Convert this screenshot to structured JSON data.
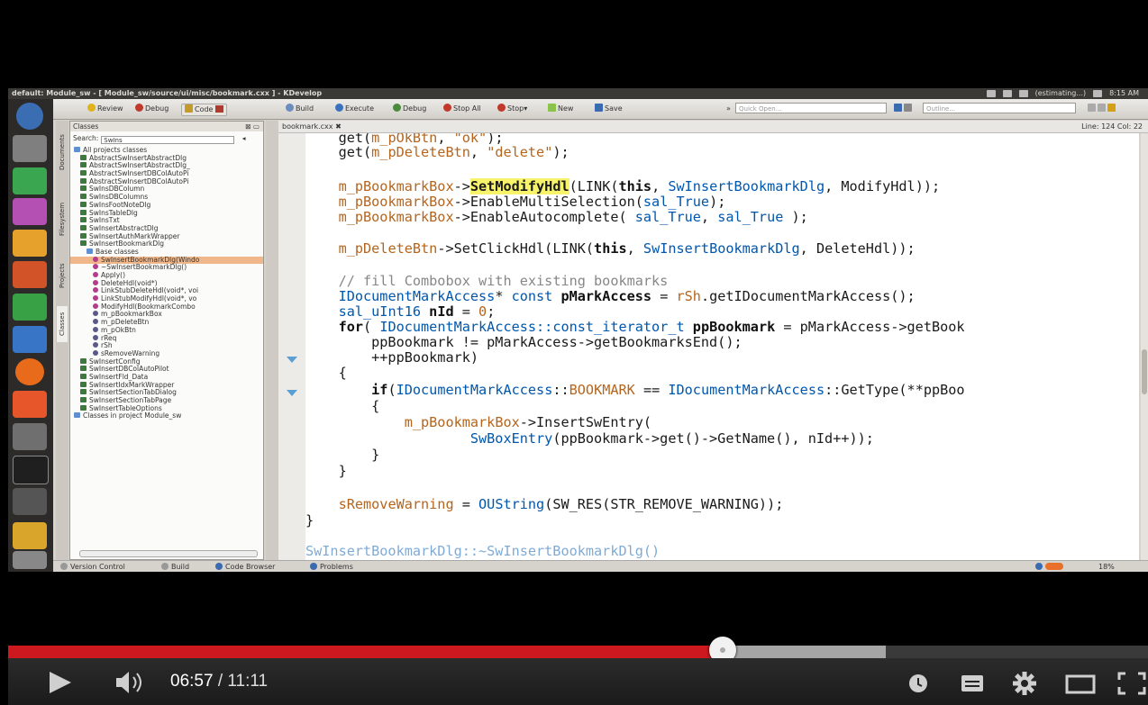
{
  "ide": {
    "window_title": "default: Module_sw - [ Module_sw/source/ui/misc/bookmark.cxx ] - KDevelop",
    "tray_status": "(estimating...)",
    "clock": "8:15 AM",
    "toolbar": {
      "review": "Review",
      "debug_area": "Debug",
      "code_area": "Code",
      "build": "Build",
      "execute": "Execute",
      "debug": "Debug",
      "stop_all": "Stop All",
      "stop": "Stop",
      "new": "New",
      "save": "Save",
      "quick_open_placeholder": "Quick Open...",
      "outline_placeholder": "Outline..."
    },
    "side_tabs": [
      "Documents",
      "Filesystem",
      "Projects",
      "Classes"
    ],
    "classes_panel": {
      "header": "Classes",
      "search_label": "Search:",
      "search_value": "SwIns",
      "tree": [
        {
          "label": "All projects classes",
          "indent": 0,
          "icon": "folder"
        },
        {
          "label": "AbstractSwInsertAbstractDlg",
          "indent": 1,
          "icon": "class"
        },
        {
          "label": "AbstractSwInsertAbstractDlg_",
          "indent": 1,
          "icon": "class"
        },
        {
          "label": "AbstractSwInsertDBColAutoPi",
          "indent": 1,
          "icon": "class"
        },
        {
          "label": "AbstractSwInsertDBColAutoPi",
          "indent": 1,
          "icon": "class"
        },
        {
          "label": "SwInsDBColumn",
          "indent": 1,
          "icon": "class"
        },
        {
          "label": "SwInsDBColumns",
          "indent": 1,
          "icon": "class"
        },
        {
          "label": "SwInsFootNoteDlg",
          "indent": 1,
          "icon": "class"
        },
        {
          "label": "SwInsTableDlg",
          "indent": 1,
          "icon": "class"
        },
        {
          "label": "SwInsTxt",
          "indent": 1,
          "icon": "class"
        },
        {
          "label": "SwInsertAbstractDlg",
          "indent": 1,
          "icon": "class"
        },
        {
          "label": "SwInsertAuthMarkWrapper",
          "indent": 1,
          "icon": "class"
        },
        {
          "label": "SwInsertBookmarkDlg",
          "indent": 1,
          "icon": "class"
        },
        {
          "label": "Base classes",
          "indent": 2,
          "icon": "folder"
        },
        {
          "label": "SwInsertBookmarkDlg(Windo",
          "indent": 3,
          "icon": "method",
          "selected": true
        },
        {
          "label": "~SwInsertBookmarkDlg()",
          "indent": 3,
          "icon": "method"
        },
        {
          "label": "Apply()",
          "indent": 3,
          "icon": "method"
        },
        {
          "label": "DeleteHdl(void*)",
          "indent": 3,
          "icon": "method"
        },
        {
          "label": "LinkStubDeleteHdl(void*, voi",
          "indent": 3,
          "icon": "method"
        },
        {
          "label": "LinkStubModifyHdl(void*, vo",
          "indent": 3,
          "icon": "method"
        },
        {
          "label": "ModifyHdl(BookmarkCombo",
          "indent": 3,
          "icon": "method"
        },
        {
          "label": "m_pBookmarkBox",
          "indent": 3,
          "icon": "member"
        },
        {
          "label": "m_pDeleteBtn",
          "indent": 3,
          "icon": "member"
        },
        {
          "label": "m_pOkBtn",
          "indent": 3,
          "icon": "member"
        },
        {
          "label": "rReq",
          "indent": 3,
          "icon": "member"
        },
        {
          "label": "rSh",
          "indent": 3,
          "icon": "member"
        },
        {
          "label": "sRemoveWarning",
          "indent": 3,
          "icon": "member"
        },
        {
          "label": "SwInsertConfig",
          "indent": 1,
          "icon": "class"
        },
        {
          "label": "SwInsertDBColAutoPilot",
          "indent": 1,
          "icon": "class"
        },
        {
          "label": "SwInsertFld_Data",
          "indent": 1,
          "icon": "class"
        },
        {
          "label": "SwInsertIdxMarkWrapper",
          "indent": 1,
          "icon": "class"
        },
        {
          "label": "SwInsertSectionTabDialog",
          "indent": 1,
          "icon": "class"
        },
        {
          "label": "SwInsertSectionTabPage",
          "indent": 1,
          "icon": "class"
        },
        {
          "label": "SwInsertTableOptions",
          "indent": 1,
          "icon": "class"
        },
        {
          "label": "Classes in project Module_sw",
          "indent": 0,
          "icon": "folder"
        }
      ]
    },
    "editor": {
      "tab_name": "bookmark.cxx",
      "line_col": "Line: 124 Col: 22"
    },
    "statusbar": {
      "version_control": "Version Control",
      "build": "Build",
      "code_browser": "Code Browser",
      "problems": "Problems",
      "zoom": "18%"
    }
  },
  "video": {
    "current_time": "06:57",
    "separator": " / ",
    "duration": "11:11",
    "played_fraction": 0.627,
    "buffered_fraction": 0.77
  }
}
